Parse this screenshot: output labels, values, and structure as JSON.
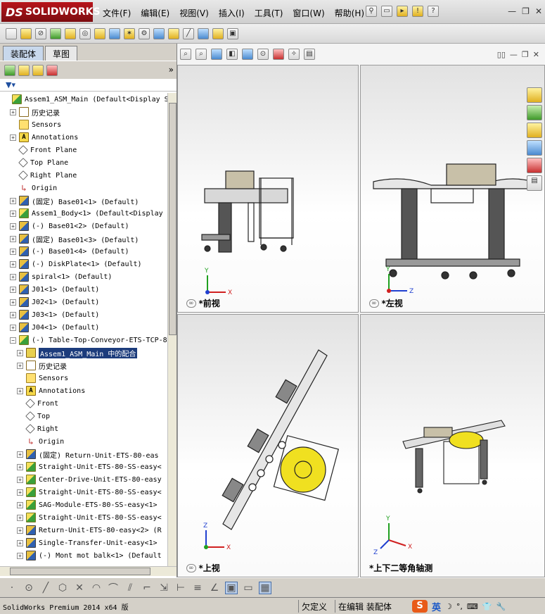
{
  "app": {
    "logo_text": "SOLIDWORKS",
    "logo_mark": "DS"
  },
  "menu": [
    "文件(F)",
    "编辑(E)",
    "视图(V)",
    "插入(I)",
    "工具(T)",
    "窗口(W)",
    "帮助(H)"
  ],
  "tabs": [
    {
      "label": "装配体",
      "active": true
    },
    {
      "label": "草图",
      "active": false
    }
  ],
  "tree": {
    "rows": [
      {
        "level": 0,
        "expander": "",
        "icon": "asm",
        "label": "Assem1_ASM_Main  (Default<Display S"
      },
      {
        "level": 1,
        "expander": "+",
        "icon": "hist",
        "label": "历史记录"
      },
      {
        "level": 1,
        "expander": "",
        "icon": "sens",
        "label": "Sensors"
      },
      {
        "level": 1,
        "expander": "+",
        "icon": "ann",
        "label": "Annotations"
      },
      {
        "level": 1,
        "expander": "",
        "icon": "plane",
        "label": "Front Plane"
      },
      {
        "level": 1,
        "expander": "",
        "icon": "plane",
        "label": "Top Plane"
      },
      {
        "level": 1,
        "expander": "",
        "icon": "plane",
        "label": "Right Plane"
      },
      {
        "level": 1,
        "expander": "",
        "icon": "orig",
        "label": "Origin"
      },
      {
        "level": 1,
        "expander": "+",
        "icon": "part",
        "label": "(固定) Base01<1> (Default)"
      },
      {
        "level": 1,
        "expander": "+",
        "icon": "asm",
        "label": "Assem1_Body<1> (Default<Display"
      },
      {
        "level": 1,
        "expander": "+",
        "icon": "part",
        "label": "(-) Base01<2> (Default)"
      },
      {
        "level": 1,
        "expander": "+",
        "icon": "part",
        "label": "(固定) Base01<3> (Default)"
      },
      {
        "level": 1,
        "expander": "+",
        "icon": "part",
        "label": "(-) Base01<4> (Default)"
      },
      {
        "level": 1,
        "expander": "+",
        "icon": "part",
        "label": "(-) DiskPlate<1> (Default)"
      },
      {
        "level": 1,
        "expander": "+",
        "icon": "part",
        "label": "spiral<1> (Default)"
      },
      {
        "level": 1,
        "expander": "+",
        "icon": "part",
        "label": "J01<1> (Default)"
      },
      {
        "level": 1,
        "expander": "+",
        "icon": "part",
        "label": "J02<1> (Default)"
      },
      {
        "level": 1,
        "expander": "+",
        "icon": "part",
        "label": "J03<1> (Default)"
      },
      {
        "level": 1,
        "expander": "+",
        "icon": "part",
        "label": "J04<1> (Default)"
      },
      {
        "level": 1,
        "expander": "−",
        "icon": "asm",
        "label": "(-) Table-Top-Conveyor-ETS-TCP-8"
      },
      {
        "level": 2,
        "expander": "+",
        "icon": "mate",
        "label": "Assem1_ASM_Main 中的配合",
        "selected": true
      },
      {
        "level": 2,
        "expander": "+",
        "icon": "hist",
        "label": "历史记录"
      },
      {
        "level": 2,
        "expander": "",
        "icon": "sens",
        "label": "Sensors"
      },
      {
        "level": 2,
        "expander": "+",
        "icon": "ann",
        "label": "Annotations"
      },
      {
        "level": 2,
        "expander": "",
        "icon": "plane",
        "label": "Front"
      },
      {
        "level": 2,
        "expander": "",
        "icon": "plane",
        "label": "Top"
      },
      {
        "level": 2,
        "expander": "",
        "icon": "plane",
        "label": "Right"
      },
      {
        "level": 2,
        "expander": "",
        "icon": "orig",
        "label": "Origin"
      },
      {
        "level": 2,
        "expander": "+",
        "icon": "part",
        "label": "(固定) Return-Unit-ETS-80-eas"
      },
      {
        "level": 2,
        "expander": "+",
        "icon": "asm",
        "label": "Straight-Unit-ETS-80-SS-easy<"
      },
      {
        "level": 2,
        "expander": "+",
        "icon": "asm",
        "label": "Center-Drive-Unit-ETS-80-easy"
      },
      {
        "level": 2,
        "expander": "+",
        "icon": "asm",
        "label": "Straight-Unit-ETS-80-SS-easy<"
      },
      {
        "level": 2,
        "expander": "+",
        "icon": "asm",
        "label": "SAG-Module-ETS-80-SS-easy<1>"
      },
      {
        "level": 2,
        "expander": "+",
        "icon": "asm",
        "label": "Straight-Unit-ETS-80-SS-easy<"
      },
      {
        "level": 2,
        "expander": "+",
        "icon": "part",
        "label": "Return-Unit-ETS-80-easy<2> (R"
      },
      {
        "level": 2,
        "expander": "+",
        "icon": "part",
        "label": "Single-Transfer-Unit-easy<1>"
      },
      {
        "level": 2,
        "expander": "+",
        "icon": "part",
        "label": "(-) Mont mot balk<1> (Default"
      }
    ]
  },
  "viewports": [
    {
      "label": "*前视",
      "axes": [
        "Y",
        "X"
      ]
    },
    {
      "label": "*左视",
      "axes": [
        "Y",
        "Z"
      ]
    },
    {
      "label": "*上视",
      "axes": [
        "Z",
        "X"
      ]
    },
    {
      "label": "*上下二等角轴测",
      "axes": [
        "Y",
        "Z",
        "X"
      ]
    }
  ],
  "status": {
    "product": "SolidWorks Premium 2014 x64 版",
    "definition": "欠定义",
    "editing": "在编辑 装配体",
    "ime_lang": "英"
  },
  "colors": {
    "accent": "#1c3c7c",
    "logo": "#b8151b",
    "axis_x": "#d02020",
    "axis_y": "#20a020",
    "axis_z": "#2040d0",
    "disk": "#f0e020"
  }
}
